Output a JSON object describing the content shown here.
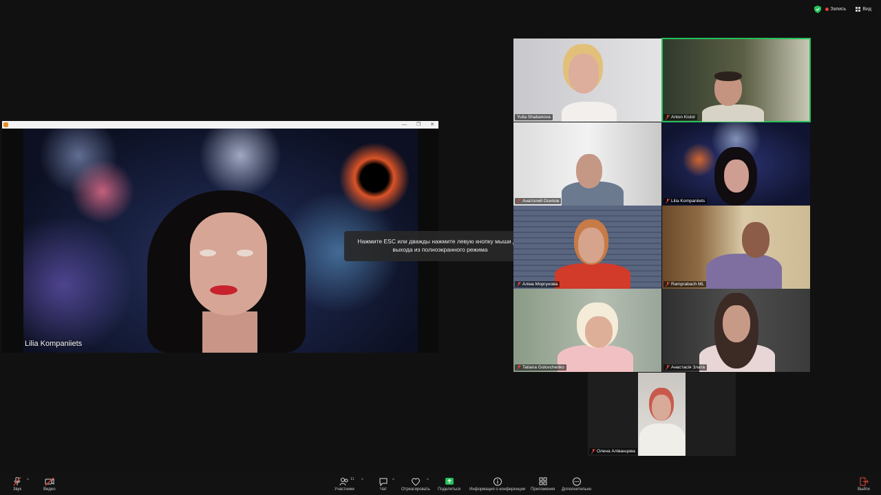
{
  "topbar": {
    "record_label": "Запись",
    "view_label": "Вид"
  },
  "share": {
    "presenter_name": "Lilia  Kompaniiets",
    "window_controls": [
      "—",
      "❐",
      "✕"
    ]
  },
  "tooltip": {
    "line1": "Нажмите ESC или дважды нажмите левую кнопку мыши для",
    "line2": "выхода из полноэкранного режима"
  },
  "participants": [
    {
      "name": "Yulia Shabanova",
      "muted": false
    },
    {
      "name": "Anton Kistol",
      "muted": true,
      "active": true
    },
    {
      "name": "Анатолий Осипов",
      "muted": true
    },
    {
      "name": "Lilia  Kompaniiets",
      "muted": true
    },
    {
      "name": "Алiна Моргунова",
      "muted": true
    },
    {
      "name": "Ramprabach ML",
      "muted": true
    },
    {
      "name": "Tatiana Golovchenko",
      "muted": true
    },
    {
      "name": "Анастасія Злата",
      "muted": true
    },
    {
      "name": "Олена Алiванцева",
      "muted": true
    }
  ],
  "toolbar": {
    "audio": "Звук",
    "video": "Видео",
    "participants": "Участники",
    "participants_count": "11",
    "chat": "Чат",
    "react": "Отреагировать",
    "share": "Поделиться",
    "info": "Информация о конференции",
    "apps": "Приложения",
    "more": "Дополнительно",
    "leave": "Выйти"
  },
  "colors": {
    "active_speaker": "#24c15a",
    "share_green": "#24c15a",
    "muted_red": "#e0453b",
    "background": "#111111"
  }
}
